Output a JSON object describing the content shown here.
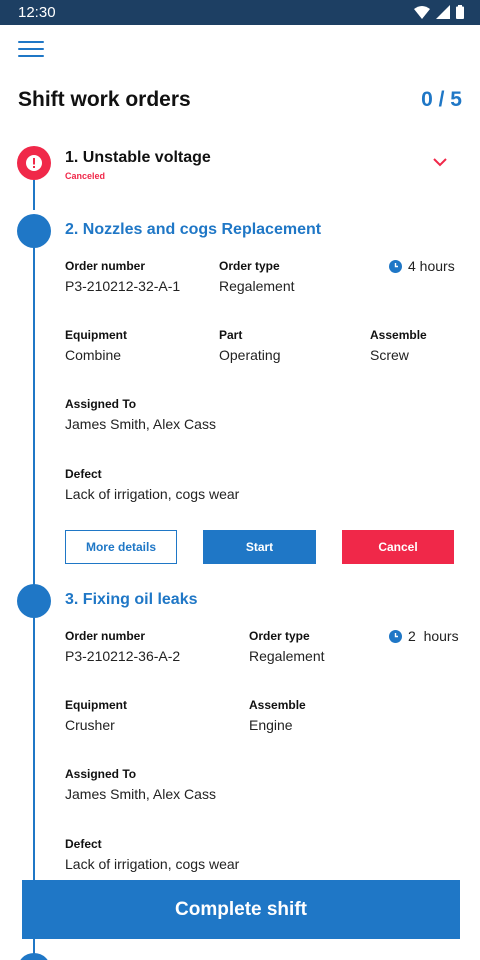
{
  "status_bar": {
    "time": "12:30",
    "icons": [
      "wifi-icon",
      "signal-icon",
      "battery-icon"
    ]
  },
  "header": {
    "title": "Shift work orders",
    "progress": "0 / 5"
  },
  "orders": [
    {
      "title": "1. Unstable voltage",
      "status": "Canceled"
    },
    {
      "title": "2. Nozzles and cogs Replacement",
      "order_number_label": "Order number",
      "order_number": "P3-210212-32-A-1",
      "order_type_label": "Order type",
      "order_type": "Regalement",
      "duration": "4 hours",
      "equipment_label": "Equipment",
      "equipment": "Combine",
      "part_label": "Part",
      "part": "Operating",
      "assemble_label": "Assemble",
      "assemble": "Screw",
      "assigned_label": "Assigned To",
      "assigned": "James Smith, Alex Cass",
      "defect_label": "Defect",
      "defect": "Lack of irrigation, cogs wear",
      "buttons": {
        "details": "More details",
        "start": "Start",
        "cancel": "Cancel"
      }
    },
    {
      "title": "3. Fixing oil leaks",
      "order_number_label": "Order number",
      "order_number": "P3-210212-36-A-2",
      "order_type_label": "Order type",
      "order_type": "Regalement",
      "duration": "2  hours",
      "equipment_label": "Equipment",
      "equipment": "Crusher",
      "assemble_label": "Assemble",
      "assemble": "Engine",
      "assigned_label": "Assigned To",
      "assigned": "James Smith, Alex Cass",
      "defect_label": "Defect",
      "defect": "Lack of irrigation, cogs wear"
    }
  ],
  "footer": {
    "complete_label": "Complete shift"
  },
  "colors": {
    "primary": "#1f77c6",
    "danger": "#f02849",
    "status_bar": "#1d3f63"
  }
}
